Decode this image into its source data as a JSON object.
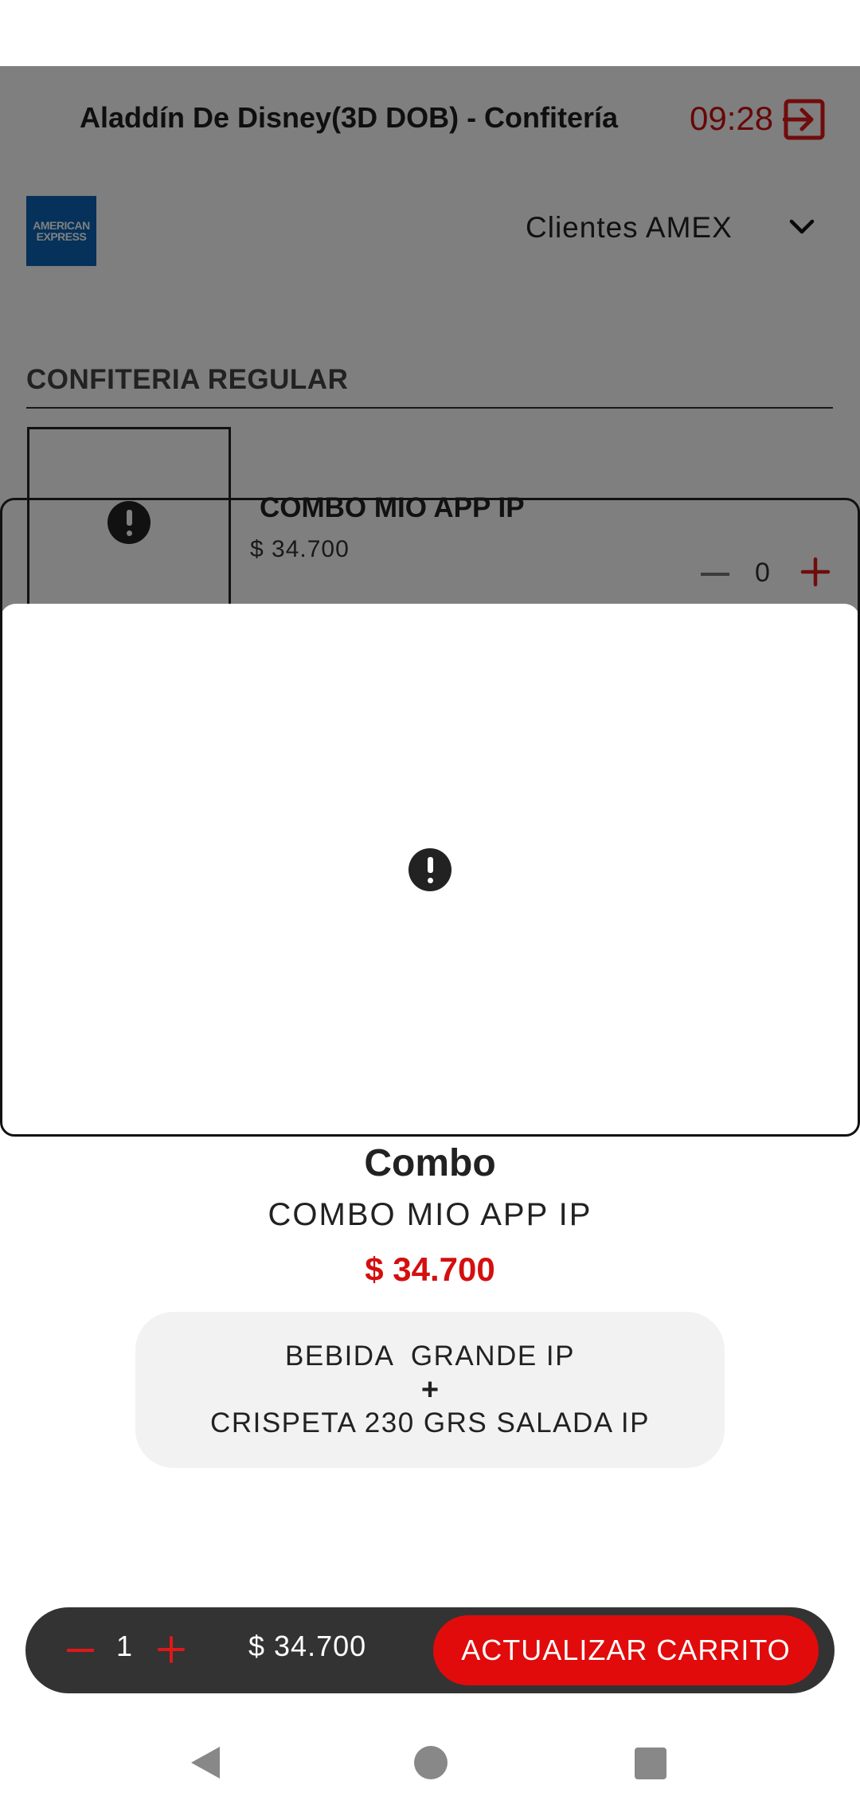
{
  "header": {
    "title": "Aladdín De Disney(3D DOB) - Confitería",
    "time": "09:28"
  },
  "payment": {
    "logo_line1": "AMERICAN",
    "logo_line2": "EXPRESS",
    "client_type": "Clientes AMEX"
  },
  "section": {
    "title": "CONFITERIA REGULAR"
  },
  "product": {
    "name": "COMBO MIO APP IP",
    "price": "$ 34.700",
    "quantity": "0"
  },
  "sheet": {
    "type_label": "Combo",
    "name": "COMBO MIO APP IP",
    "price": "$ 34.700",
    "contents": [
      "BEBIDA  GRANDE IP",
      "CRISPETA 230 GRS SALADA IP"
    ],
    "contents_separator": "+"
  },
  "cart": {
    "quantity": "1",
    "total": "$ 34.700",
    "button_label": "ACTUALIZAR CARRITO"
  },
  "colors": {
    "accent_red": "#e10b0b",
    "price_red": "#d40f0f",
    "amex_blue": "#0a63b4",
    "cart_bar_bg": "#333333"
  }
}
